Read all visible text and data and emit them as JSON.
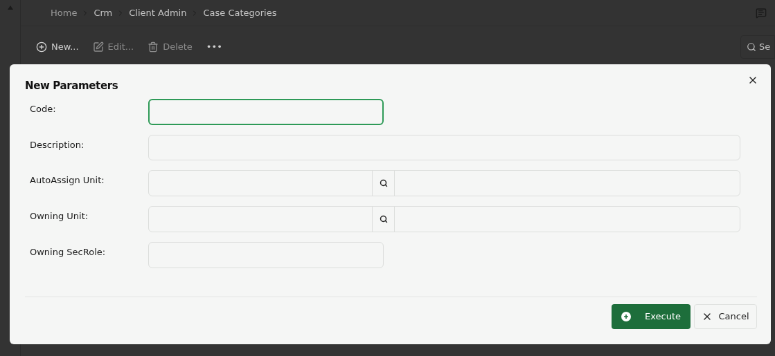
{
  "breadcrumb": [
    {
      "label": "Home",
      "current": false
    },
    {
      "label": "Crm",
      "current": true
    },
    {
      "label": "Client Admin",
      "current": true
    },
    {
      "label": "Case Categories",
      "current": true
    }
  ],
  "toolbar": [
    {
      "label": "New...",
      "kind": "new",
      "disabled": false
    },
    {
      "label": "Edit...",
      "kind": "edit",
      "disabled": true
    },
    {
      "label": "Delete",
      "kind": "delete",
      "disabled": true
    },
    {
      "label": "•••",
      "kind": "more",
      "disabled": false
    }
  ],
  "search": {
    "placeholder": "Se"
  },
  "dialog": {
    "title": "New Parameters",
    "fields": [
      {
        "label": "Code:",
        "kind": "short",
        "focused": true
      },
      {
        "label": "Description:",
        "kind": "text",
        "focused": false
      },
      {
        "label": "AutoAssign Unit:",
        "kind": "lookup",
        "focused": false
      },
      {
        "label": "Owning Unit:",
        "kind": "lookup",
        "focused": false
      },
      {
        "label": "Owning SecRole:",
        "kind": "short",
        "focused": false
      }
    ],
    "buttons": [
      {
        "label": "Execute",
        "kind": "primary"
      },
      {
        "label": "Cancel",
        "kind": "cancel"
      }
    ]
  }
}
